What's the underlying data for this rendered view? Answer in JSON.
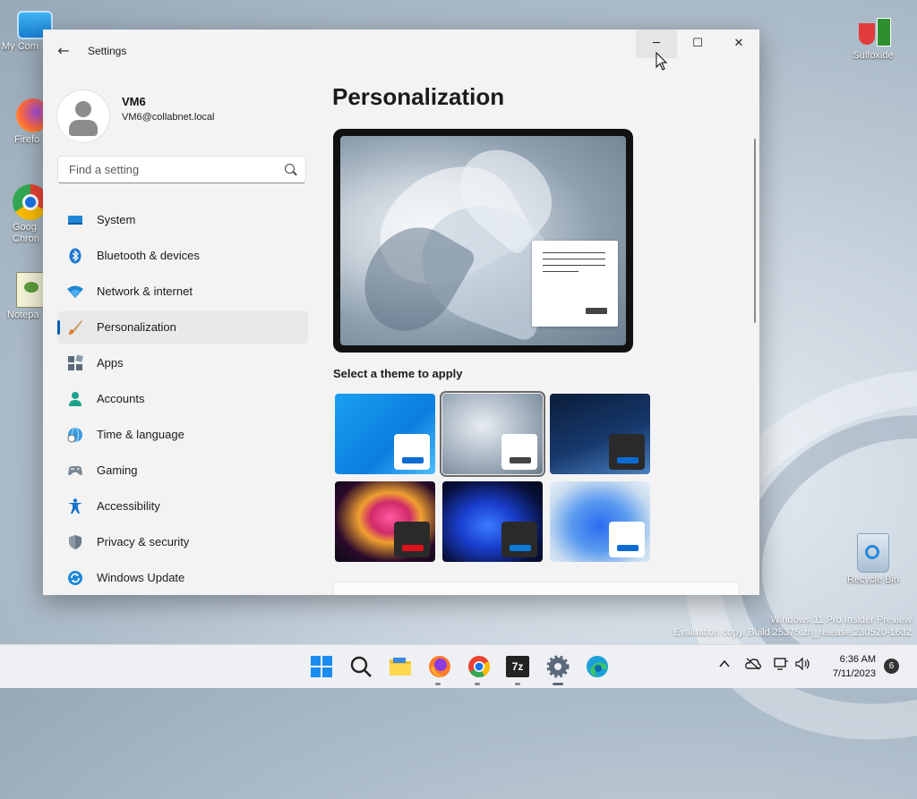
{
  "desktop": {
    "icons": [
      {
        "label": "My Com"
      },
      {
        "label": "Firefo"
      },
      {
        "label": "Goog Chron"
      },
      {
        "label": "Notepa"
      },
      {
        "label": "Sulfoxide"
      },
      {
        "label": "Recycle Bin"
      }
    ],
    "watermark": {
      "line1": "Windows 11 Pro Insider Preview",
      "line2": "Evaluation copy. Build 25375.zn_release.230520-1632"
    }
  },
  "window": {
    "title": "Settings",
    "controls": {
      "minimize": "─",
      "maximize": "☐",
      "close": "✕"
    },
    "back": "←"
  },
  "user": {
    "name": "VM6",
    "email": "VM6@collabnet.local"
  },
  "search": {
    "placeholder": "Find a setting"
  },
  "nav": {
    "items": [
      {
        "label": "System",
        "icon": "monitor-icon"
      },
      {
        "label": "Bluetooth & devices",
        "icon": "bluetooth-icon"
      },
      {
        "label": "Network & internet",
        "icon": "wifi-icon"
      },
      {
        "label": "Personalization",
        "icon": "brush-icon",
        "active": true
      },
      {
        "label": "Apps",
        "icon": "apps-icon"
      },
      {
        "label": "Accounts",
        "icon": "person-icon"
      },
      {
        "label": "Time & language",
        "icon": "globe-clock-icon"
      },
      {
        "label": "Gaming",
        "icon": "gamepad-icon"
      },
      {
        "label": "Accessibility",
        "icon": "accessibility-icon"
      },
      {
        "label": "Privacy & security",
        "icon": "shield-icon"
      },
      {
        "label": "Windows Update",
        "icon": "update-icon"
      }
    ]
  },
  "main": {
    "title": "Personalization",
    "theme_label": "Select a theme to apply",
    "themes": [
      {
        "name": "windows-light",
        "selected": false
      },
      {
        "name": "windows-glow",
        "selected": true
      },
      {
        "name": "windows-dark",
        "selected": false
      },
      {
        "name": "captured-motion",
        "selected": false
      },
      {
        "name": "sunrise-dark",
        "selected": false
      },
      {
        "name": "flow-light",
        "selected": false
      }
    ]
  },
  "taskbar": {
    "apps": [
      "start-icon",
      "search-icon",
      "file-explorer-icon",
      "firefox-icon",
      "chrome-icon",
      "7zip-icon",
      "settings-icon",
      "edge-icon"
    ],
    "time": "6:36 AM",
    "date": "7/11/2023",
    "notification_count": "6",
    "sevenzip_text": "7z"
  },
  "colors": {
    "accent": "#005fb8"
  }
}
